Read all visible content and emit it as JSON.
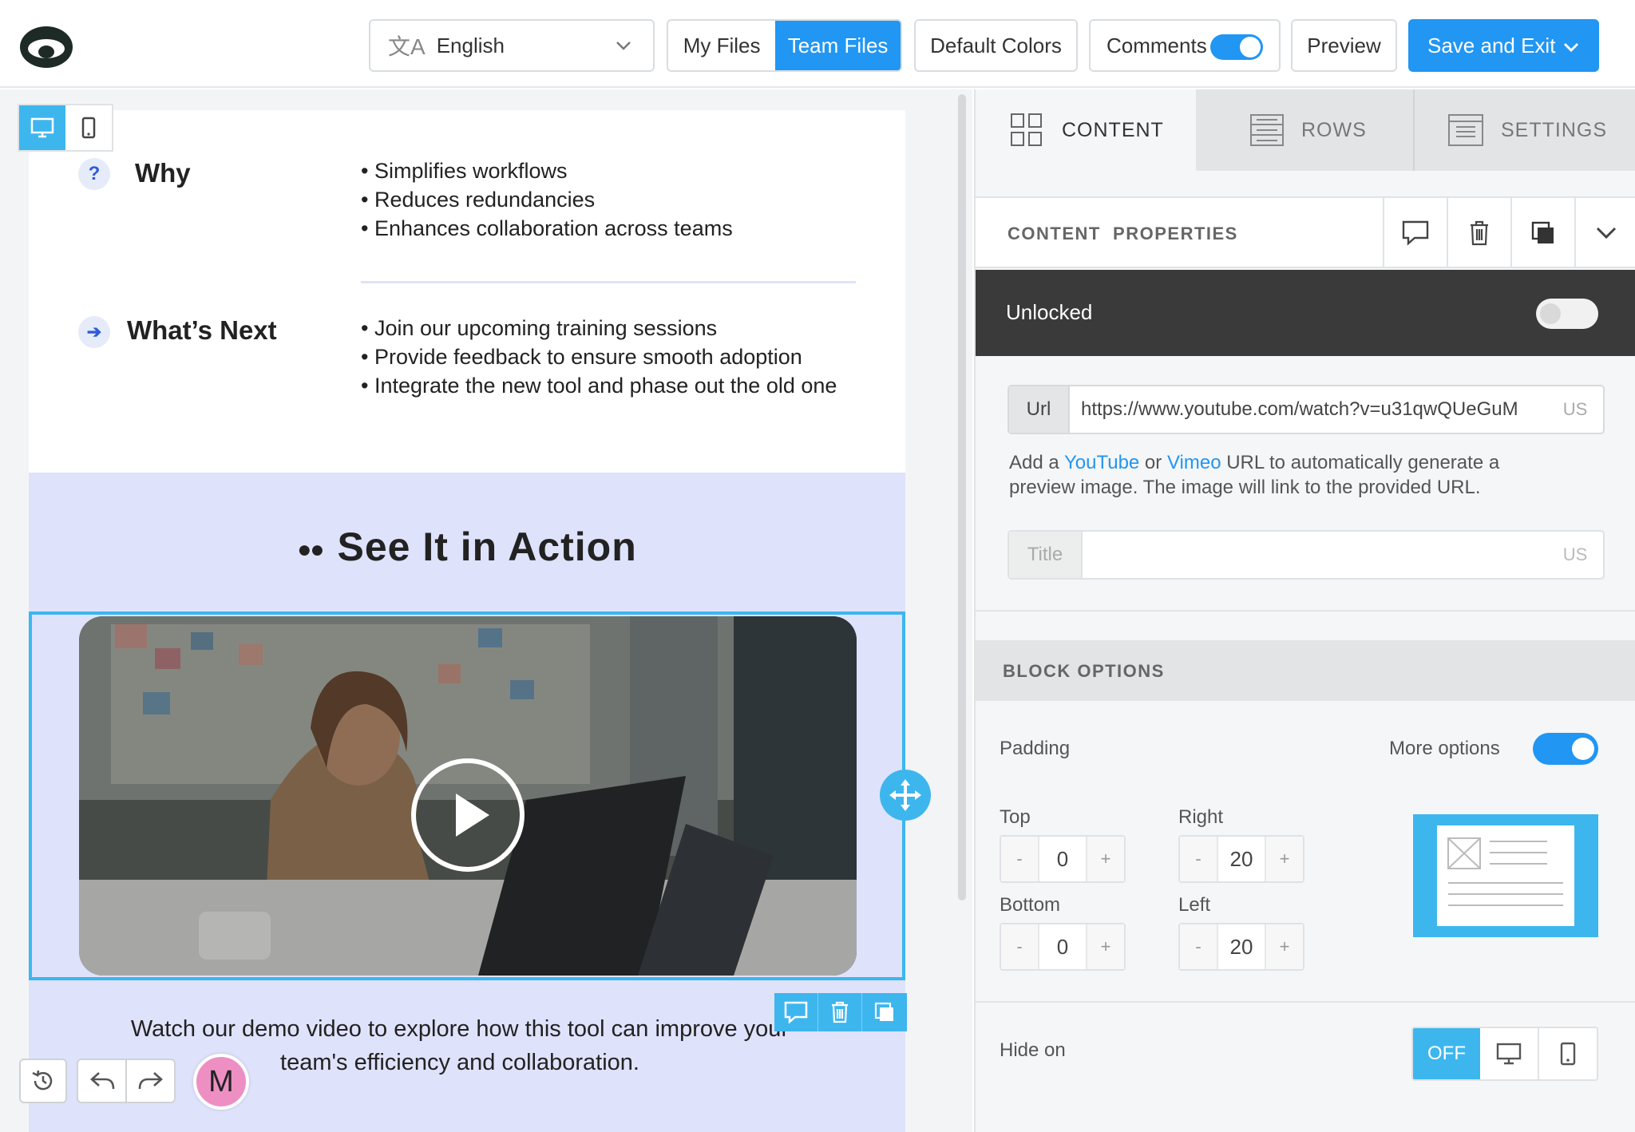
{
  "topbar": {
    "language_label": "English",
    "my_files_label": "My Files",
    "team_files_label": "Team Files",
    "default_colors_label": "Default Colors",
    "comments_label": "Comments",
    "preview_label": "Preview",
    "save_exit_label": "Save and Exit"
  },
  "email": {
    "why_title": "Why",
    "why_bullets": [
      "• Simplifies workflows",
      "• Reduces redundancies",
      "• Enhances collaboration across teams"
    ],
    "next_title": "What’s Next",
    "next_bullets": [
      "• Join our upcoming training sessions",
      "• Provide feedback to ensure smooth adoption",
      "• Integrate the new tool and phase out the old one"
    ],
    "action_heading": "See It in Action",
    "action_desc_line1": "Watch our demo video to explore how this tool can improve your",
    "action_desc_line2": "team's efficiency and collaboration."
  },
  "user_avatar_initial": "M",
  "panel": {
    "tabs": [
      "CONTENT",
      "ROWS",
      "SETTINGS"
    ],
    "content_properties_label": "CONTENT  PROPERTIES",
    "lock_label": "Unlocked",
    "url_label": "Url",
    "url_value": "https://www.youtube.com/watch?v=u31qwQUeGuM",
    "url_lang": "US",
    "help_prefix": "Add a ",
    "help_youtube": "YouTube",
    "help_or": " or ",
    "help_vimeo": "Vimeo",
    "help_suffix": " URL to automatically generate a",
    "help_line2": "preview image. The image will link to the provided URL.",
    "title_label": "Title",
    "title_value": "",
    "title_lang": "US",
    "block_options_label": "BLOCK OPTIONS",
    "padding_label": "Padding",
    "more_options_label": "More options",
    "padding_top_label": "Top",
    "padding_top": "0",
    "padding_right_label": "Right",
    "padding_right": "20",
    "padding_bottom_label": "Bottom",
    "padding_bottom": "0",
    "padding_left_label": "Left",
    "padding_left": "20",
    "hide_on_label": "Hide on",
    "hide_off_label": "OFF",
    "stepper_minus": "-",
    "stepper_plus": "+"
  },
  "colors": {
    "accent": "#2196f3",
    "selection": "#3db6ee",
    "dark_bar": "#3a3a3a",
    "lavender": "#dfe2fb"
  }
}
